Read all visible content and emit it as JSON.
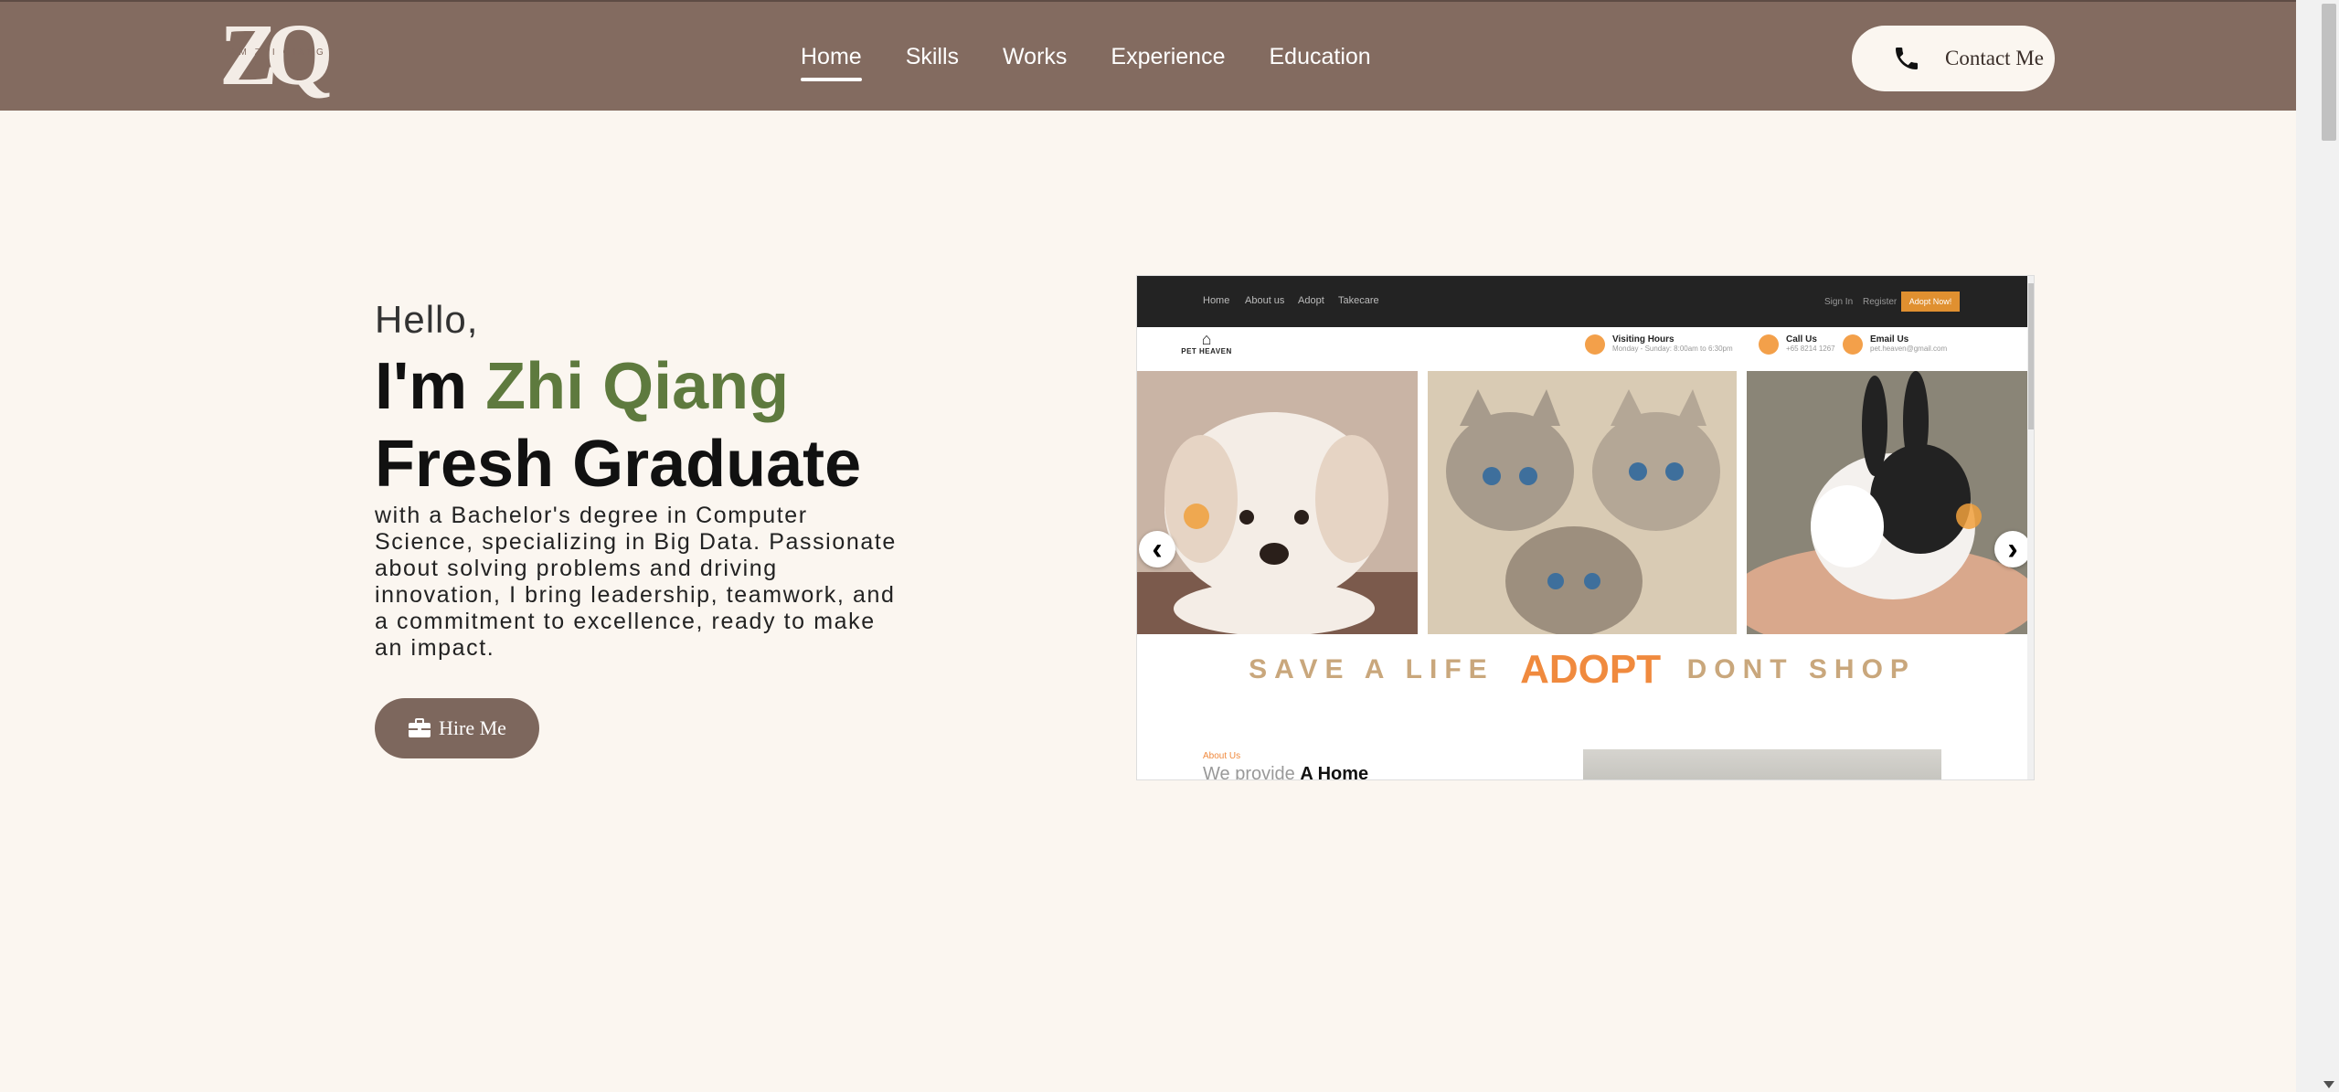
{
  "header": {
    "logo_text": "ZQ",
    "logo_subtext": "LAM ZHI QIANG",
    "nav": [
      {
        "label": "Home",
        "active": true
      },
      {
        "label": "Skills",
        "active": false
      },
      {
        "label": "Works",
        "active": false
      },
      {
        "label": "Experience",
        "active": false
      },
      {
        "label": "Education",
        "active": false
      }
    ],
    "contact_label": "Contact Me",
    "contact_icon": "phone-icon"
  },
  "hero": {
    "greeting": "Hello,",
    "intro_prefix": "I'm ",
    "name": "Zhi Qiang",
    "role": "Fresh Graduate",
    "description": "with a Bachelor's degree in Computer Science, specializing in Big Data. Passionate about solving problems and driving innovation, I bring leadership, teamwork, and a commitment to excellence, ready to make an impact.",
    "hire_label": "Hire Me",
    "hire_icon": "briefcase-icon"
  },
  "preview": {
    "nav": [
      "Home",
      "About us",
      "Adopt",
      "Takecare"
    ],
    "sign_in": "Sign In",
    "register": "Register",
    "adopt_now": "Adopt Now!",
    "logo_text": "PET HEAVEN",
    "info": [
      {
        "title": "Visiting Hours",
        "detail": "Monday - Sunday: 8:00am to 6:30pm"
      },
      {
        "title": "Call Us",
        "detail": "+65 8214 1267"
      },
      {
        "title": "Email Us",
        "detail": "pet.heaven@gmail.com"
      }
    ],
    "slogan_left": "SAVE A LIFE",
    "slogan_mid": "ADOPT",
    "slogan_right": "DONT SHOP",
    "about_label": "About Us",
    "provide_prefix": "We provide",
    "provide_bold": "A Home",
    "prev_arrow": "‹",
    "next_arrow": "›"
  },
  "colors": {
    "header_bg": "#836b60",
    "page_bg": "#fbf6f0",
    "accent_green": "#5e7a3e",
    "button_bg": "#7d675d"
  }
}
